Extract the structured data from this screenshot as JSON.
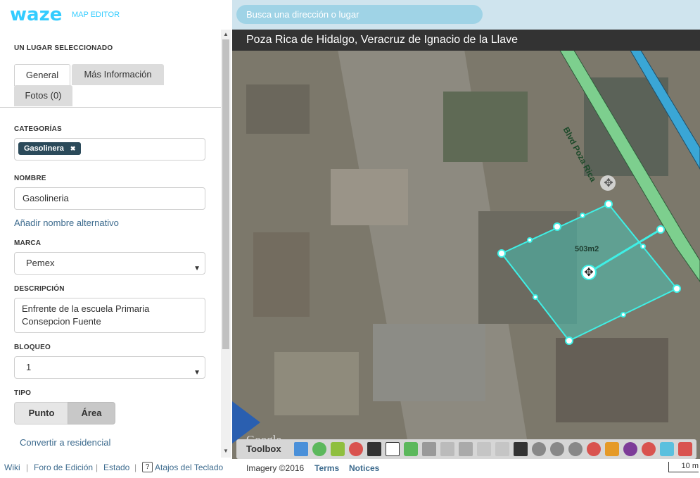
{
  "app": {
    "logo": "waze",
    "subtitle": "MAP EDITOR"
  },
  "panel": {
    "heading": "UN LUGAR SELECCIONADO",
    "tabs": {
      "general": "General",
      "more_info": "Más Información",
      "photos": "Fotos (0)"
    },
    "categories_label": "CATEGORÍAS",
    "category_chip": "Gasolinera",
    "chip_remove": "✖",
    "name_label": "NOMBRE",
    "name_value": "Gasolineria",
    "add_alt_name": "Añadir nombre alternativo",
    "brand_label": "MARCA",
    "brand_value": "Pemex",
    "description_label": "DESCRIPCIÓN",
    "description_value": "Enfrente de la escuela Primaria Consepcion Fuente",
    "lock_label": "BLOQUEO",
    "lock_value": "1",
    "type_label": "TIPO",
    "type_point": "Punto",
    "type_area": "Área",
    "convert_link": "Convertir a residencial"
  },
  "footer": {
    "wiki": "Wiki",
    "forum": "Foro de Edición",
    "status": "Estado",
    "shortcuts": "Atajos del Teclado",
    "help_icon": "?"
  },
  "map": {
    "search_placeholder": "Busca una dirección o lugar",
    "location": "Poza Rica de Hidalgo, Veracruz de Ignacio de la Llave",
    "street_label": "Blvd Poza Rica",
    "area_label": "503m2",
    "google": "Google",
    "toolbox": "Toolbox",
    "imagery": "Imagery ©2016",
    "terms": "Terms",
    "notices": "Notices",
    "scale": "10 m"
  },
  "colors": {
    "accent": "#33ccff",
    "chip_bg": "#2b4a5a",
    "link": "#3d6b8e",
    "area_fill": "#3fd1c4",
    "road_green": "#7dcf8e",
    "road_blue": "#3aa6d6"
  }
}
